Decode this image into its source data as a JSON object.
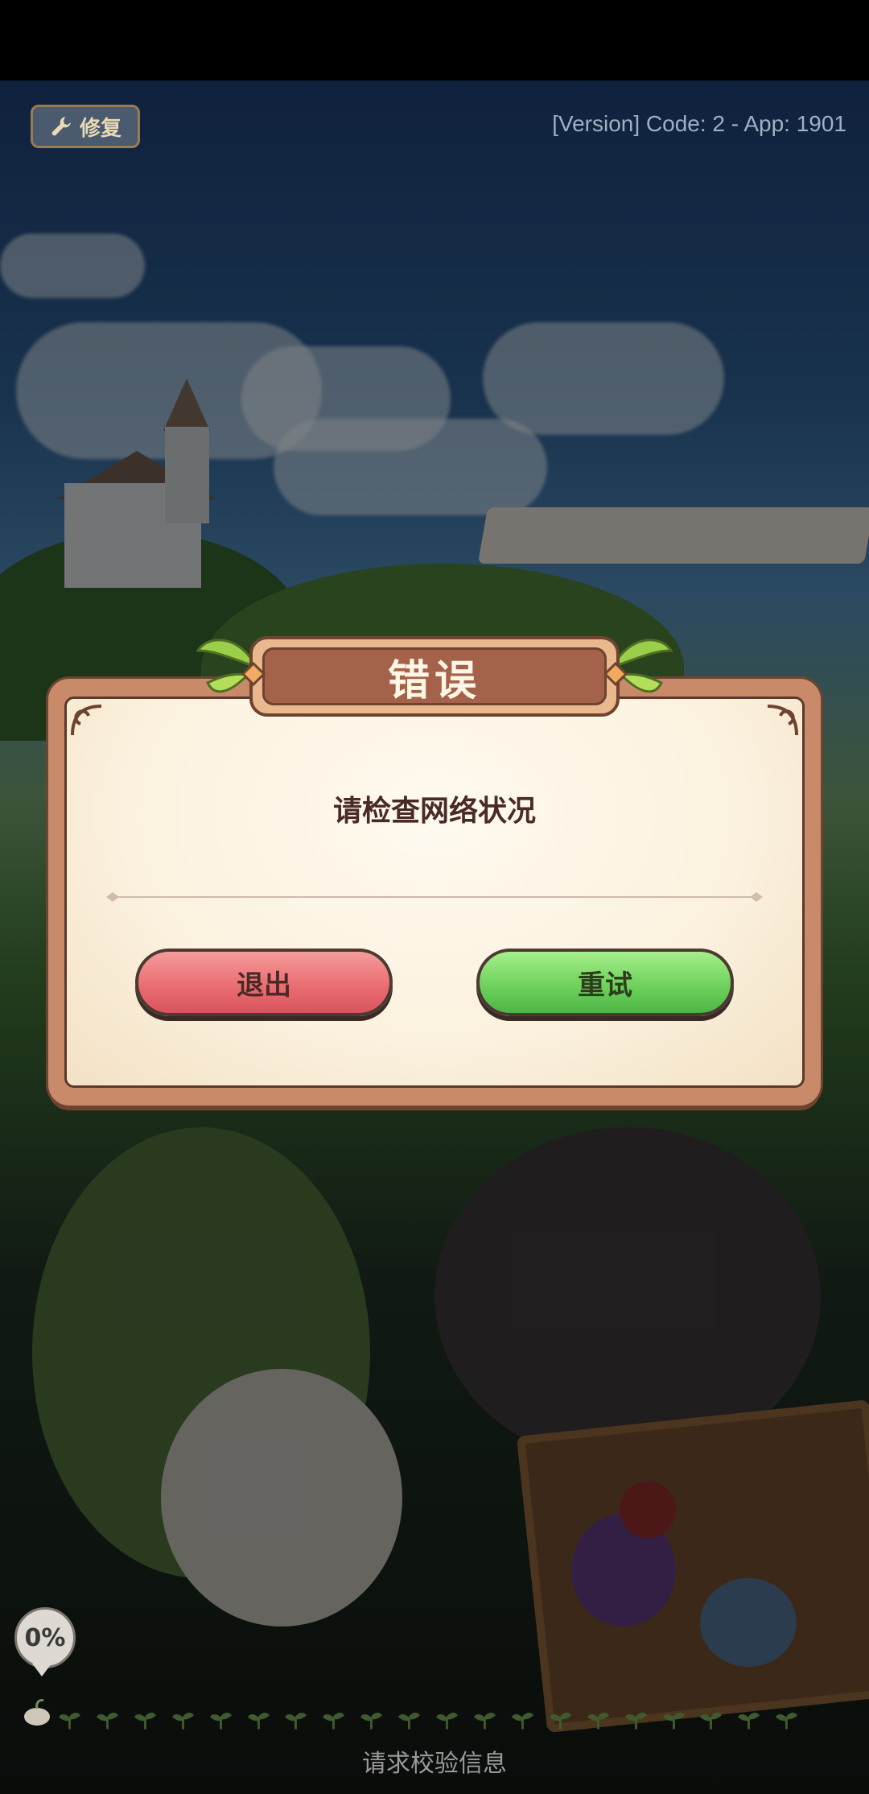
{
  "header": {
    "repair_button_label": "修复",
    "version_text": "[Version] Code: 2 - App: 1901"
  },
  "dialog": {
    "title": "错误",
    "message": "请检查网络状况",
    "exit_label": "退出",
    "retry_label": "重试"
  },
  "loading": {
    "progress_percent": 0,
    "progress_label": "0%",
    "status_text": "请求校验信息",
    "sprout_count": 20
  },
  "colors": {
    "exit_button": "#ea6e73",
    "retry_button": "#6fd25c",
    "dialog_frame": "#c98a69",
    "title_plate": "#a5624a"
  },
  "icons": {
    "repair": "wrench-icon",
    "progress": "sprout-icon"
  }
}
